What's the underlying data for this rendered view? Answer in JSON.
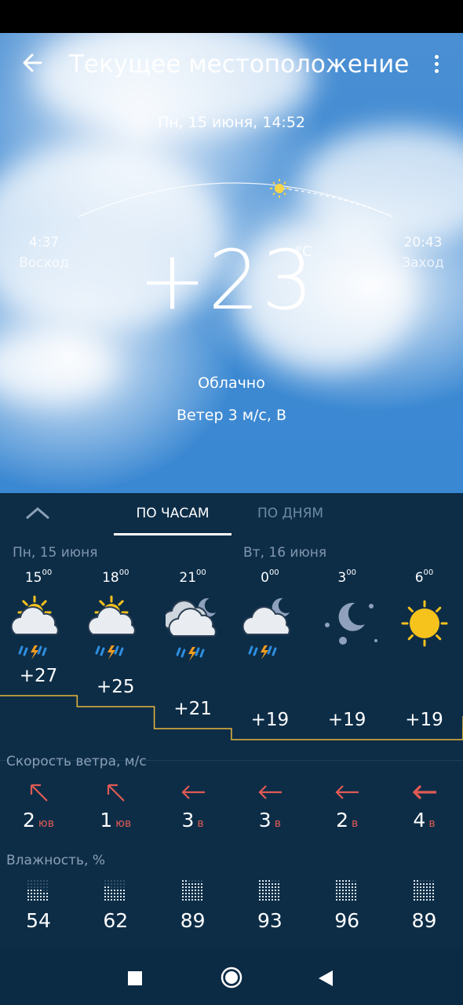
{
  "header": {
    "title": "Текущее местоположение"
  },
  "current": {
    "datetime": "Пн, 15 июня, 14:52",
    "sunrise_time": "4:37",
    "sunrise_label": "Восход",
    "sunset_time": "20:43",
    "sunset_label": "Заход",
    "temperature": "+23",
    "unit": "°C",
    "condition": "Облачно",
    "wind": "Ветер 3 м/с, В"
  },
  "tabs": {
    "hours": "ПО ЧАСАМ",
    "days": "ПО ДНЯМ"
  },
  "days": {
    "today": "Пн, 15 июня",
    "tomorrow": "Вт, 16 июня"
  },
  "hours": [
    {
      "h": "15",
      "m": "00",
      "icon": "sun-cloud-thunderstorm-icon",
      "temp": "+27",
      "wind_speed": "2",
      "wind_dir": "юв",
      "humidity": "54"
    },
    {
      "h": "18",
      "m": "00",
      "icon": "sun-cloud-thunderstorm-icon",
      "temp": "+25",
      "wind_speed": "1",
      "wind_dir": "юв",
      "humidity": "62"
    },
    {
      "h": "21",
      "m": "00",
      "icon": "moon-clouds-thunderstorm-icon",
      "temp": "+21",
      "wind_speed": "3",
      "wind_dir": "в",
      "humidity": "89"
    },
    {
      "h": "0",
      "m": "00",
      "icon": "moon-cloud-thunderstorm-icon",
      "temp": "+19",
      "wind_speed": "3",
      "wind_dir": "в",
      "humidity": "93"
    },
    {
      "h": "3",
      "m": "00",
      "icon": "moon-stars-icon",
      "temp": "+19",
      "wind_speed": "2",
      "wind_dir": "в",
      "humidity": "96"
    },
    {
      "h": "6",
      "m": "00",
      "icon": "sun-icon",
      "temp": "+19",
      "wind_speed": "4",
      "wind_dir": "в",
      "humidity": "89"
    }
  ],
  "sections": {
    "wind": "Скорость ветра, м/с",
    "humidity": "Влажность, %"
  },
  "colors": {
    "panel": "#0d2d47",
    "temp_line": "#e8b73c",
    "wind_dir": "#e05a54",
    "sky": "#3d8ad3"
  }
}
